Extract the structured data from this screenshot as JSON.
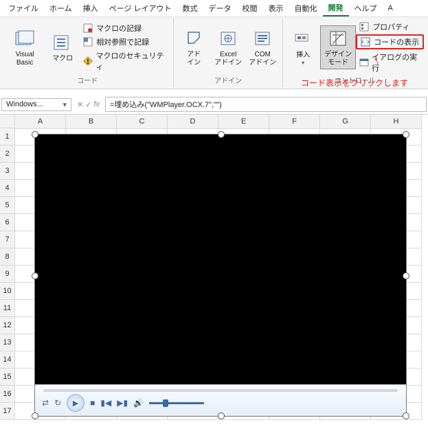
{
  "menubar": [
    "ファイル",
    "ホーム",
    "挿入",
    "ページ レイアウト",
    "数式",
    "データ",
    "校閲",
    "表示",
    "自動化",
    "開発",
    "ヘルプ",
    "A"
  ],
  "menubar_active_index": 9,
  "ribbon": {
    "code_group": {
      "label": "コード",
      "visual_basic": "Visual Basic",
      "macros": "マクロ",
      "record_macro": "マクロの記録",
      "relative_ref": "相対参照で記録",
      "macro_security": "マクロのセキュリティ"
    },
    "addins_group": {
      "label": "アドイン",
      "addins": "アド\nイン",
      "excel_addins": "Excel\nアドイン",
      "com_addins": "COM\nアドイン"
    },
    "controls_group": {
      "label": "コントロール",
      "insert": "挿入",
      "design_mode": "デザイン\nモード",
      "properties": "プロパティ",
      "view_code": "コードの表示",
      "run_dialog": "イアログの実行"
    }
  },
  "annotation": "コード表示をクリックします",
  "name_box": "Windows...",
  "formula": "=埋め込み(\"WMPlayer.OCX.7\",\"\")",
  "columns": [
    "A",
    "B",
    "C",
    "D",
    "E",
    "F",
    "G",
    "H"
  ],
  "rows": [
    "1",
    "2",
    "3",
    "4",
    "5",
    "6",
    "7",
    "8",
    "9",
    "10",
    "11",
    "12",
    "13",
    "14",
    "15",
    "16",
    "17"
  ]
}
